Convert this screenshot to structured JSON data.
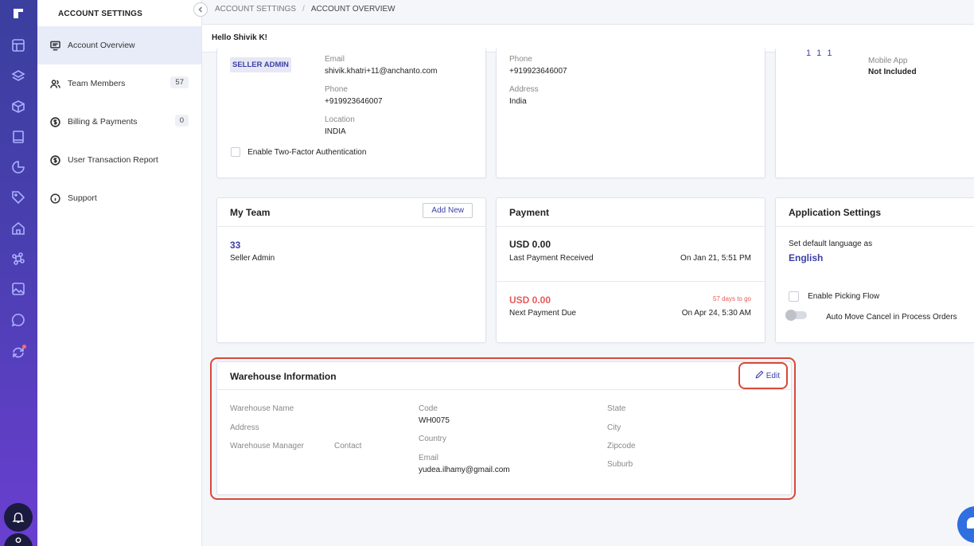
{
  "breadcrumb": {
    "root": "ACCOUNT SETTINGS",
    "separator": "/",
    "current": "ACCOUNT OVERVIEW"
  },
  "greeting": "Hello Shivik K!",
  "sidebar": {
    "title": "ACCOUNT SETTINGS",
    "items": [
      {
        "label": "Account Overview",
        "icon": "monitor-icon",
        "count": ""
      },
      {
        "label": "Team Members",
        "icon": "users-icon",
        "count": "57"
      },
      {
        "label": "Billing & Payments",
        "icon": "dollar-circle-icon",
        "count": "0"
      },
      {
        "label": "User Transaction Report",
        "icon": "dollar-circle-icon",
        "count": ""
      },
      {
        "label": "Support",
        "icon": "info-icon",
        "count": ""
      }
    ]
  },
  "rail_icons": [
    "logo-icon",
    "layout-icon",
    "layers-icon",
    "box-icon",
    "book-icon",
    "pie-chart-icon",
    "tag-icon",
    "home-icon",
    "command-icon",
    "image-icon",
    "message-icon",
    "sync-icon",
    "bell-icon",
    "user-icon"
  ],
  "profile": {
    "role_badge": "SELLER ADMIN",
    "email_label": "Email",
    "email": "shivik.khatri+11@anchanto.com",
    "phone_label": "Phone",
    "phone": "+919923646007",
    "location_label": "Location",
    "location": "INDIA",
    "two_factor_label": "Enable Two-Factor Authentication"
  },
  "company": {
    "phone_label": "Phone",
    "phone": "+919923646007",
    "address_label": "Address",
    "address": "India"
  },
  "plan": {
    "partial_text": "1 1 1",
    "mobile_app_label": "Mobile App",
    "mobile_app_value": "Not Included"
  },
  "my_team": {
    "title": "My Team",
    "add_new": "Add New",
    "count": "33",
    "role": "Seller Admin"
  },
  "payment": {
    "title": "Payment",
    "last_amount": "USD 0.00",
    "last_label": "Last Payment Received",
    "last_date": "On Jan 21, 5:51 PM",
    "due_amount": "USD 0.00",
    "due_days": "57 days to go",
    "due_label": "Next Payment Due",
    "due_date": "On Apr 24, 5:30 AM"
  },
  "app_settings": {
    "title": "Application Settings",
    "language_label": "Set default language as",
    "language": "English",
    "picking_flow": "Enable Picking Flow",
    "auto_move": "Auto Move Cancel in Process Orders"
  },
  "warehouse": {
    "title": "Warehouse Information",
    "edit": "Edit",
    "name_label": "Warehouse Name",
    "address_label": "Address",
    "manager_label": "Warehouse Manager",
    "contact_label": "Contact",
    "code_label": "Code",
    "code": "WH0075",
    "country_label": "Country",
    "email_label": "Email",
    "email": "yudea.ilhamy@gmail.com",
    "state_label": "State",
    "city_label": "City",
    "zipcode_label": "Zipcode",
    "suburb_label": "Suburb"
  },
  "colors": {
    "accent": "#3d3fa8",
    "danger": "#e85a5a",
    "highlight": "#d9483b"
  }
}
